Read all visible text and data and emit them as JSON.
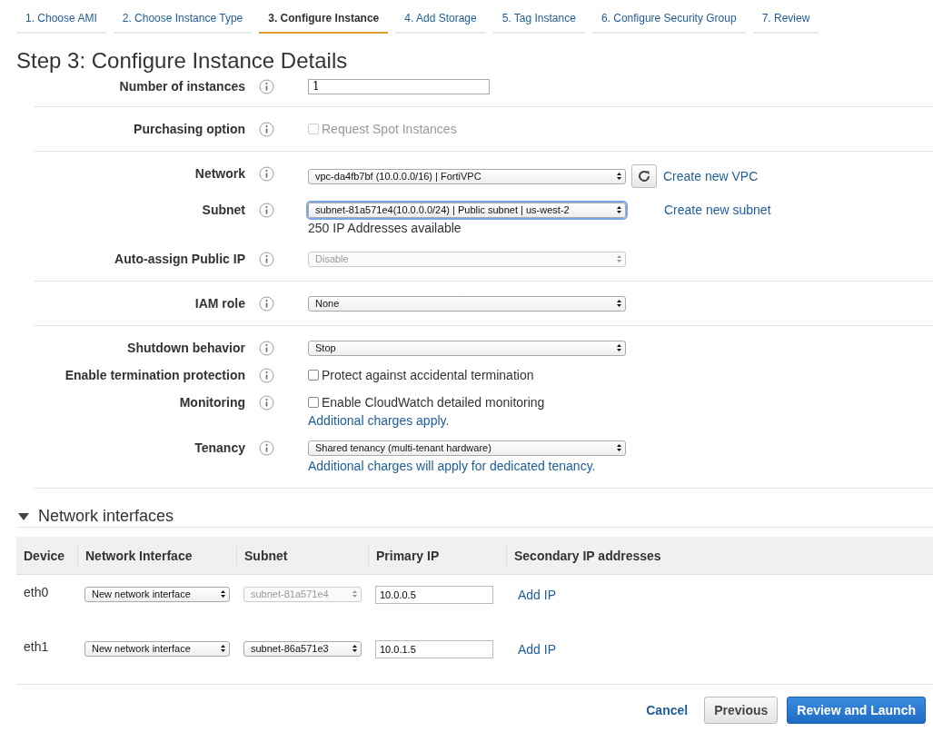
{
  "tabs": [
    {
      "label": "1. Choose AMI",
      "selected": false
    },
    {
      "label": "2. Choose Instance Type",
      "selected": false
    },
    {
      "label": "3. Configure Instance",
      "selected": true
    },
    {
      "label": "4. Add Storage",
      "selected": false
    },
    {
      "label": "5. Tag Instance",
      "selected": false
    },
    {
      "label": "6. Configure Security Group",
      "selected": false
    },
    {
      "label": "7. Review",
      "selected": false
    }
  ],
  "title": "Step 3: Configure Instance Details",
  "groups": [
    [
      {
        "label": "Number of instances",
        "kind": "input",
        "value": "1"
      }
    ],
    [
      {
        "label": "Purchasing option",
        "kind": "checkbox",
        "text": "Request Spot Instances",
        "checked": false,
        "disabled": true
      }
    ],
    [
      {
        "label": "Network",
        "kind": "select",
        "value": "vpc-da4fb7bf (10.0.0.0/16) | FortiVPC",
        "disabled": false,
        "focused": false,
        "refresh": true,
        "link": "Create new VPC"
      },
      {
        "label": "Subnet",
        "kind": "select",
        "value": "subnet-81a571e4(10.0.0.0/24) | Public subnet | us-west-2",
        "disabled": false,
        "focused": true,
        "link": "Create new subnet",
        "note": "250 IP Addresses available"
      },
      {
        "label": "Auto-assign Public IP",
        "kind": "select",
        "value": "Disable",
        "disabled": true,
        "focused": false
      }
    ],
    [
      {
        "label": "IAM role",
        "kind": "select",
        "value": "None",
        "disabled": false,
        "focused": false
      }
    ],
    [
      {
        "label": "Shutdown behavior",
        "kind": "select",
        "value": "Stop",
        "disabled": false,
        "focused": false
      },
      {
        "label": "Enable termination protection",
        "kind": "checkbox",
        "text": "Protect against accidental termination",
        "checked": false,
        "disabled": false
      },
      {
        "label": "Monitoring",
        "kind": "checkbox",
        "text": "Enable CloudWatch detailed monitoring",
        "checked": false,
        "disabled": false,
        "note_link": "Additional charges apply."
      },
      {
        "label": "Tenancy",
        "kind": "select",
        "value": "Shared tenancy (multi-tenant hardware)",
        "disabled": false,
        "focused": false,
        "note_link": "Additional charges will apply for dedicated tenancy."
      }
    ]
  ],
  "network_interfaces": {
    "title": "Network interfaces",
    "expanded": true,
    "columns": [
      "Device",
      "Network Interface",
      "Subnet",
      "Primary IP",
      "Secondary IP addresses"
    ],
    "rows": [
      {
        "device": "eth0",
        "interface": "New network interface",
        "subnet": "subnet-81a571e4",
        "subnet_disabled": true,
        "primary_ip": "10.0.0.5",
        "action": "Add IP"
      },
      {
        "device": "eth1",
        "interface": "New network interface",
        "subnet": "subnet-86a571e3",
        "subnet_disabled": false,
        "primary_ip": "10.0.1.5",
        "action": "Add IP"
      }
    ]
  },
  "footer": {
    "cancel": "Cancel",
    "previous": "Previous",
    "primary": "Review and Launch"
  }
}
